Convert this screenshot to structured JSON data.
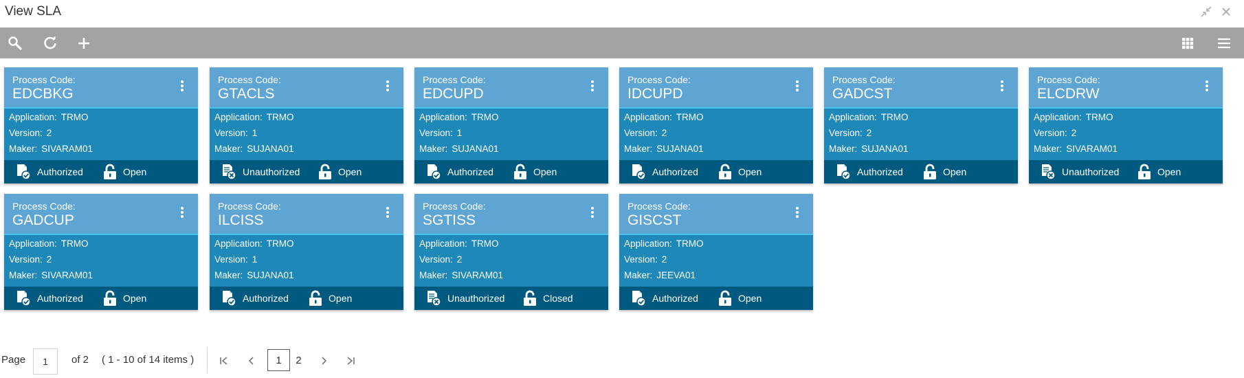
{
  "window": {
    "title": "View SLA"
  },
  "cards_labels": {
    "process_code": "Process Code:",
    "application": "Application:",
    "version": "Version:",
    "maker": "Maker:"
  },
  "cards": [
    {
      "code": "EDCBKG",
      "application": "TRMO",
      "version": "2",
      "maker": "SIVARAM01",
      "auth": "Authorized",
      "auth_icon": "authorized-doc-icon",
      "status": "Open",
      "status_icon": "unlock-icon"
    },
    {
      "code": "GTACLS",
      "application": "TRMO",
      "version": "1",
      "maker": "SUJANA01",
      "auth": "Unauthorized",
      "auth_icon": "unauthorized-doc-icon",
      "status": "Open",
      "status_icon": "unlock-icon"
    },
    {
      "code": "EDCUPD",
      "application": "TRMO",
      "version": "1",
      "maker": "SUJANA01",
      "auth": "Authorized",
      "auth_icon": "authorized-doc-icon",
      "status": "Open",
      "status_icon": "unlock-icon"
    },
    {
      "code": "IDCUPD",
      "application": "TRMO",
      "version": "2",
      "maker": "SUJANA01",
      "auth": "Authorized",
      "auth_icon": "authorized-doc-icon",
      "status": "Open",
      "status_icon": "unlock-icon"
    },
    {
      "code": "GADCST",
      "application": "TRMO",
      "version": "2",
      "maker": "SUJANA01",
      "auth": "Authorized",
      "auth_icon": "authorized-doc-icon",
      "status": "Open",
      "status_icon": "unlock-icon"
    },
    {
      "code": "ELCDRW",
      "application": "TRMO",
      "version": "2",
      "maker": "SIVARAM01",
      "auth": "Unauthorized",
      "auth_icon": "unauthorized-doc-icon",
      "status": "Open",
      "status_icon": "unlock-icon"
    },
    {
      "code": "GADCUP",
      "application": "TRMO",
      "version": "2",
      "maker": "SIVARAM01",
      "auth": "Authorized",
      "auth_icon": "authorized-doc-icon",
      "status": "Open",
      "status_icon": "unlock-icon"
    },
    {
      "code": "ILCISS",
      "application": "TRMO",
      "version": "1",
      "maker": "SUJANA01",
      "auth": "Authorized",
      "auth_icon": "authorized-doc-icon",
      "status": "Open",
      "status_icon": "unlock-icon"
    },
    {
      "code": "SGTISS",
      "application": "TRMO",
      "version": "2",
      "maker": "SIVARAM01",
      "auth": "Unauthorized",
      "auth_icon": "unauthorized-doc-icon",
      "status": "Closed",
      "status_icon": "unlock-icon"
    },
    {
      "code": "GISCST",
      "application": "TRMO",
      "version": "2",
      "maker": "JEEVA01",
      "auth": "Authorized",
      "auth_icon": "authorized-doc-icon",
      "status": "Open",
      "status_icon": "unlock-icon"
    }
  ],
  "pager": {
    "page_label": "Page",
    "current_page": "1",
    "of_pages": "of 2",
    "items_summary": "( 1 - 10 of 14 items )",
    "pages": [
      "1",
      "2"
    ]
  }
}
